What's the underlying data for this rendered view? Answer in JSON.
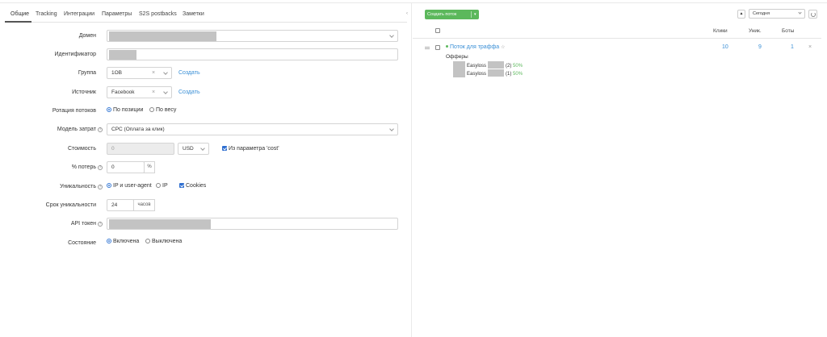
{
  "tabs": [
    "Общие",
    "Tracking",
    "Интеграции",
    "Параметры",
    "S2S postbacks",
    "Заметки"
  ],
  "collapse_icon": "chevron-left-icon",
  "form": {
    "domain_label": "Домен",
    "identifier_label": "Идентификатор",
    "group_label": "Группа",
    "group_value": "1OB",
    "group_create": "Создать",
    "source_label": "Источник",
    "source_value": "Facebook",
    "source_create": "Создать",
    "rotation_label": "Ротация потоков",
    "rotation_options": [
      "По позиции",
      "По весу"
    ],
    "cost_model_label": "Модель затрат",
    "cost_model_value": "CPC (Оплата за клик)",
    "cost_label": "Стоимость",
    "cost_value": "0",
    "currency_value": "USD",
    "cost_param_label": "Из параметра 'cost'",
    "loss_label": "% потерь",
    "loss_value": "0",
    "loss_unit": "%",
    "uniqueness_label": "Уникальность",
    "uniqueness_options": [
      "IP и user-agent",
      "IP"
    ],
    "cookies_label": "Cookies",
    "uniq_period_label": "Срок уникальности",
    "uniq_period_value": "24",
    "uniq_period_unit": "часов",
    "api_token_label": "API токен",
    "state_label": "Состояние",
    "state_options": [
      "Включена",
      "Выключена"
    ]
  },
  "right": {
    "create_stream": "Создать поток",
    "sort_icon": "sort-up-icon",
    "period_value": "Сегодня",
    "refresh_icon": "refresh-icon",
    "columns": [
      "Клики",
      "Уник.",
      "Боты"
    ],
    "stream": {
      "name": "Поток для траффа",
      "clicks": "10",
      "unique": "9",
      "bots": "1",
      "offers_title": "Офферы",
      "offers": [
        {
          "name": "Easyloss",
          "count": "(2)",
          "pct": "50%"
        },
        {
          "name": "Easyloss",
          "count": "(1)",
          "pct": "50%"
        }
      ]
    }
  },
  "colors": {
    "accent_green": "#5cb85c",
    "link_blue": "#3a8fd6",
    "redaction": "#c3c3c3"
  }
}
